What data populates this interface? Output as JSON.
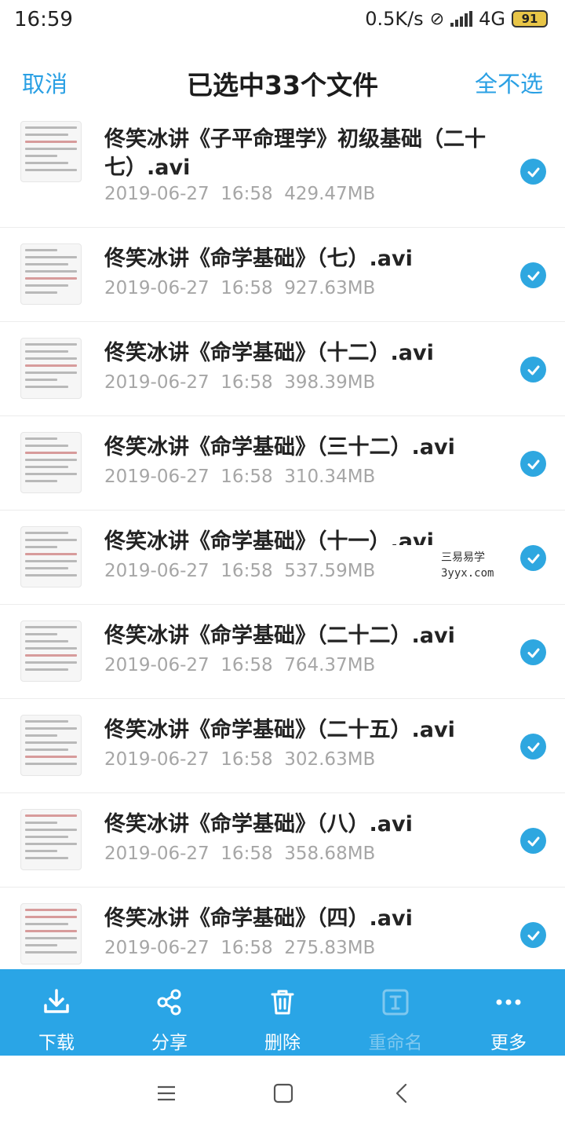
{
  "status_bar": {
    "time": "16:59",
    "network_speed": "0.5K/s",
    "network_type": "4G",
    "battery_level": "91"
  },
  "header": {
    "cancel_label": "取消",
    "title": "已选中33个文件",
    "select_none_label": "全不选"
  },
  "files": [
    {
      "name": "佟笑冰讲《子平命理学》初级基础（二十七）.avi",
      "date": "2019-06-27",
      "time": "16:58",
      "size": "429.47MB",
      "checked": true
    },
    {
      "name": "佟笑冰讲《命学基础》（七）.avi",
      "date": "2019-06-27",
      "time": "16:58",
      "size": "927.63MB",
      "checked": true
    },
    {
      "name": "佟笑冰讲《命学基础》（十二）.avi",
      "date": "2019-06-27",
      "time": "16:58",
      "size": "398.39MB",
      "checked": true
    },
    {
      "name": "佟笑冰讲《命学基础》（三十二）.avi",
      "date": "2019-06-27",
      "time": "16:58",
      "size": "310.34MB",
      "checked": true
    },
    {
      "name": "佟笑冰讲《命学基础》（十一）.avi",
      "date": "2019-06-27",
      "time": "16:58",
      "size": "537.59MB",
      "checked": true
    },
    {
      "name": "佟笑冰讲《命学基础》（二十二）.avi",
      "date": "2019-06-27",
      "time": "16:58",
      "size": "764.37MB",
      "checked": true
    },
    {
      "name": "佟笑冰讲《命学基础》（二十五）.avi",
      "date": "2019-06-27",
      "time": "16:58",
      "size": "302.63MB",
      "checked": true
    },
    {
      "name": "佟笑冰讲《命学基础》（八）.avi",
      "date": "2019-06-27",
      "time": "16:58",
      "size": "358.68MB",
      "checked": true
    },
    {
      "name": "佟笑冰讲《命学基础》（四）.avi",
      "date": "2019-06-27",
      "time": "16:58",
      "size": "275.83MB",
      "checked": true
    }
  ],
  "watermark": {
    "line1": "三易易学",
    "line2": "3yyx.com"
  },
  "actions": [
    {
      "label": "下载",
      "icon": "download-icon",
      "enabled": true
    },
    {
      "label": "分享",
      "icon": "share-icon",
      "enabled": true
    },
    {
      "label": "删除",
      "icon": "trash-icon",
      "enabled": true
    },
    {
      "label": "重命名",
      "icon": "rename-icon",
      "enabled": false
    },
    {
      "label": "更多",
      "icon": "more-icon",
      "enabled": true
    }
  ],
  "nav": {
    "icons": [
      "menu-icon",
      "home-icon",
      "back-icon"
    ]
  },
  "colors": {
    "accent": "#2aa0e4",
    "action_bar": "#2aa5e6",
    "meta_text": "#a6a6a6"
  }
}
